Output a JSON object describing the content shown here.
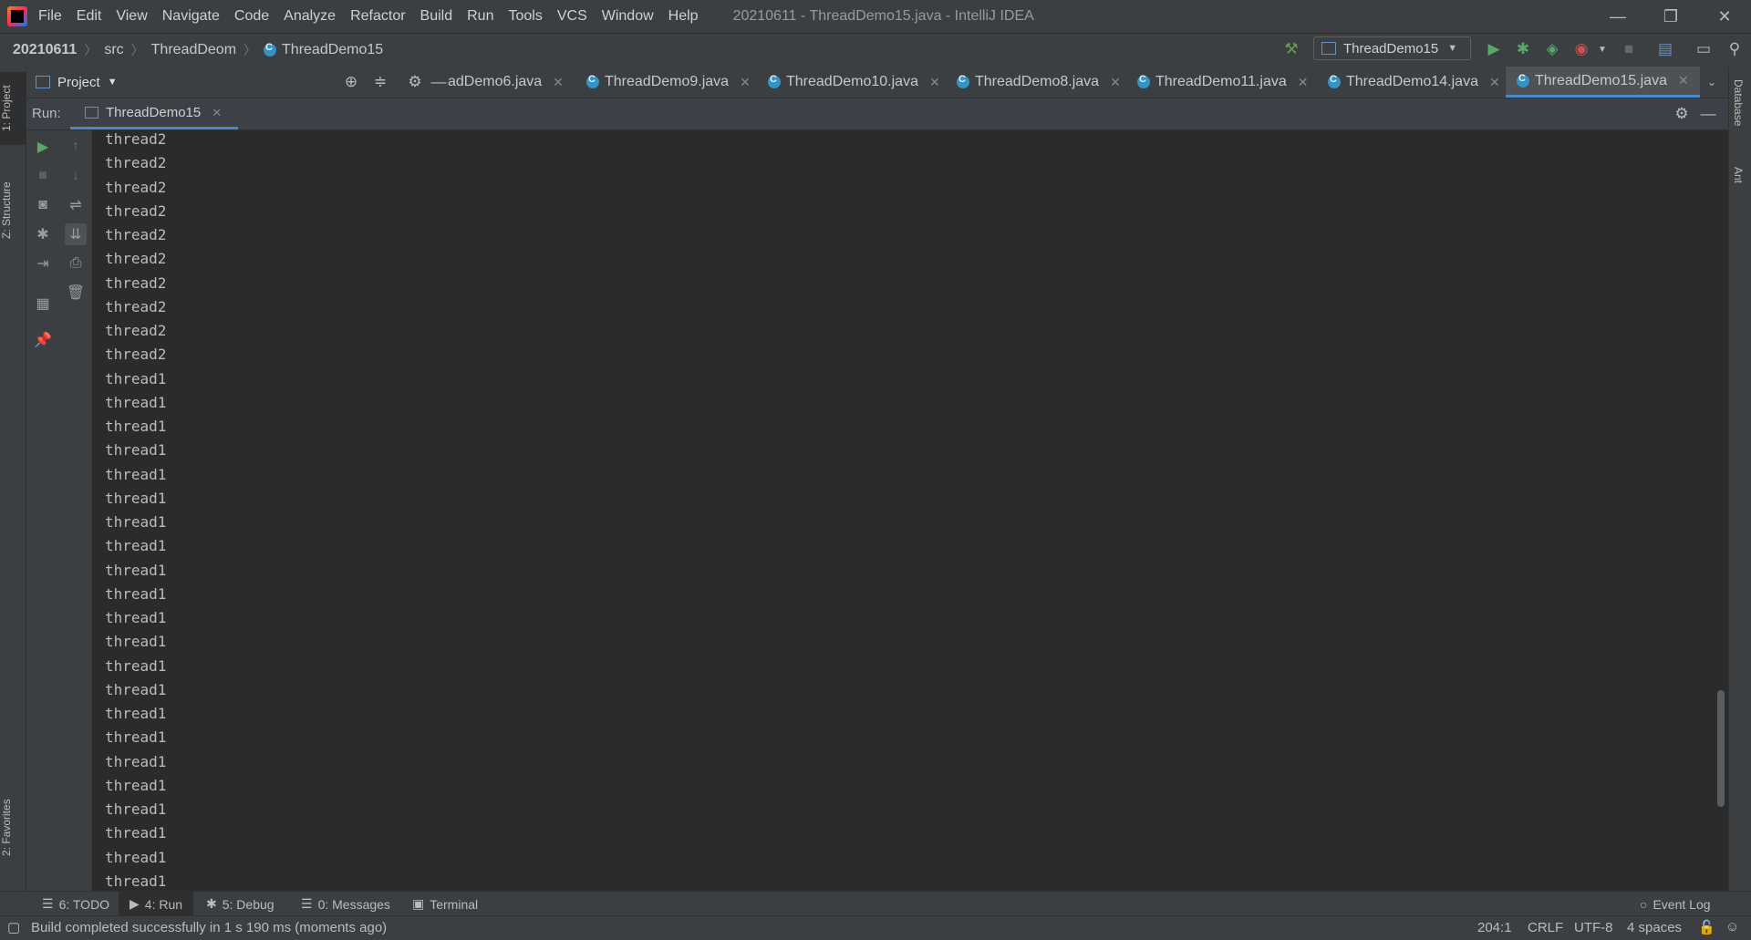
{
  "menu": [
    "File",
    "Edit",
    "View",
    "Navigate",
    "Code",
    "Analyze",
    "Refactor",
    "Build",
    "Run",
    "Tools",
    "VCS",
    "Window",
    "Help"
  ],
  "window_title": "20210611 - ThreadDemo15.java - IntelliJ IDEA",
  "breadcrumbs": {
    "project": "20210611",
    "src": "src",
    "module": "ThreadDeom",
    "file": "ThreadDemo15"
  },
  "run_config": "ThreadDemo15",
  "left_tabs": {
    "project": "1: Project",
    "structure": "Z: Structure",
    "favorites": "2: Favorites"
  },
  "right_tabs": {
    "database": "Database",
    "ant": "Ant"
  },
  "project_panel_title": "Project",
  "editor_tabs": [
    "adDemo6.java",
    "ThreadDemo9.java",
    "ThreadDemo10.java",
    "ThreadDemo8.java",
    "ThreadDemo11.java",
    "ThreadDemo14.java",
    "ThreadDemo15.java"
  ],
  "run_panel": {
    "label": "Run:",
    "tab": "ThreadDemo15"
  },
  "console_lines": [
    "thread2",
    "thread2",
    "thread2",
    "thread2",
    "thread2",
    "thread2",
    "thread2",
    "thread2",
    "thread2",
    "thread2",
    "thread1",
    "thread1",
    "thread1",
    "thread1",
    "thread1",
    "thread1",
    "thread1",
    "thread1",
    "thread1",
    "thread1",
    "thread1",
    "thread1",
    "thread1",
    "thread1",
    "thread1",
    "thread1",
    "thread1",
    "thread1",
    "thread1",
    "thread1",
    "thread1",
    "thread1"
  ],
  "bottom_tools": {
    "todo": "6: TODO",
    "run": "4: Run",
    "debug": "5: Debug",
    "messages": "0: Messages",
    "terminal": "Terminal",
    "event_log": "Event Log"
  },
  "status": {
    "message": "Build completed successfully in 1 s 190 ms (moments ago)",
    "position": "204:1",
    "line_sep": "CRLF",
    "encoding": "UTF-8",
    "indent": "4 spaces"
  }
}
